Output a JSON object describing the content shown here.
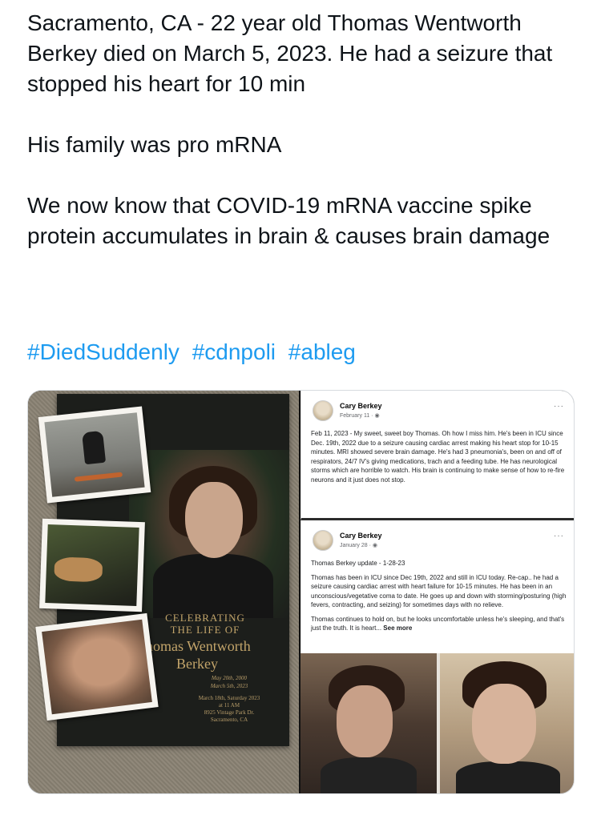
{
  "tweet": {
    "line1": "Sacramento, CA - 22 year old Thomas Wentworth Berkey died on March 5, 2023. He had a seizure that stopped his heart for 10 min",
    "line2": "His family was pro mRNA",
    "line3": "We now know that COVID-19 mRNA vaccine spike protein accumulates in brain & causes brain damage",
    "hashtags": [
      "#DiedSuddenly",
      "#cdnpoli",
      "#ableg"
    ]
  },
  "memorial_card": {
    "heading_line1": "CELEBRATING",
    "heading_line2": "THE LIFE OF",
    "name_line1": "Thomas Wentworth",
    "name_line2": "Berkey",
    "born": "May 20th, 2000",
    "died": "March 5th, 2023",
    "service_date": "March 18th, Saturday 2023",
    "service_time": "at 11 AM",
    "service_address": "8925 Vintage Park Dr.",
    "service_city": "Sacramento, CA"
  },
  "facebook_posts": [
    {
      "author": "Cary Berkey",
      "date": "February 11 · ",
      "menu": "···",
      "paragraphs": [
        "Feb 11, 2023 - My sweet, sweet boy Thomas. Oh how I miss him. He's been in ICU since Dec. 19th, 2022 due to a seizure causing cardiac arrest making his heart stop for 10-15 minutes. MRI showed severe brain damage. He's had 3 pneumonia's, been on and off of respirators, 24/7 IV's giving medications, trach and a feeding tube. He has neurological storms which are horrible to watch. His brain is continuing to make sense of how to re-fire neurons and it just does not stop."
      ]
    },
    {
      "author": "Cary Berkey",
      "date": "January 28 · ",
      "menu": "···",
      "paragraphs": [
        "Thomas Berkey update - 1-28-23",
        "Thomas has been in ICU since Dec 19th, 2022 and still in ICU today. Re-cap.. he had a seizure causing cardiac arrest with heart failure for 10-15 minutes. He has been in an unconscious/vegetative coma to date. He goes up and down with storming/posturing (high fevers, contracting, and seizing) for sometimes days with no relieve.",
        "Thomas continues to hold on, but he looks uncomfortable unless he's sleeping, and that's just the truth. It is heart..."
      ],
      "see_more": "See more"
    }
  ],
  "icons": {
    "globe": "globe-icon",
    "menu": "more-options-icon"
  }
}
